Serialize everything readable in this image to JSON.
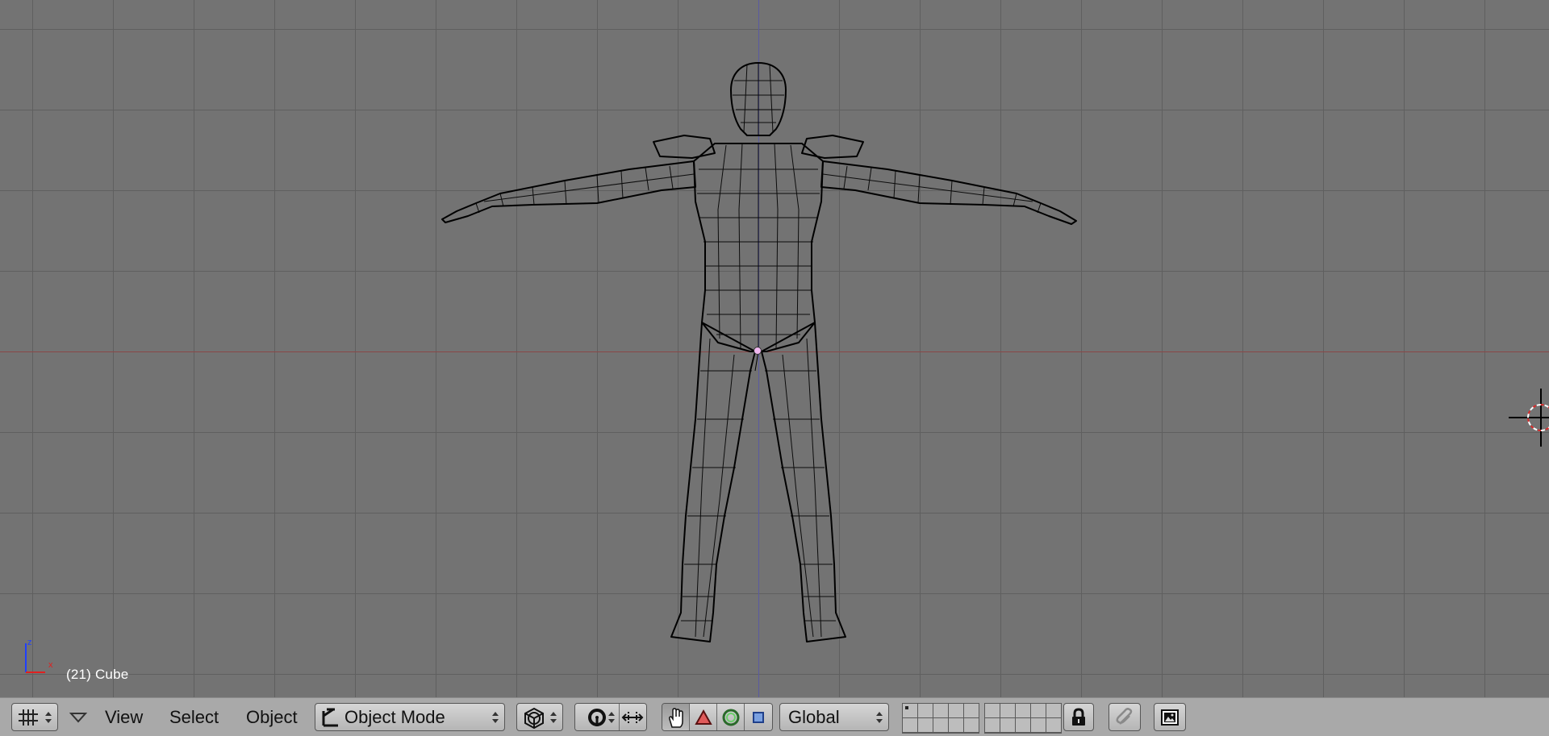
{
  "viewport": {
    "object_info": "(21) Cube",
    "axis_labels": {
      "z": "z",
      "x": "x"
    },
    "colors": {
      "background": "#737373",
      "grid": "#5f5f5f",
      "x_axis": "#8a4848",
      "z_axis": "#5a5aa0",
      "wire": "#000000"
    }
  },
  "header": {
    "window_type_icon": "grid-icon",
    "menus": {
      "view": "View",
      "select": "Select",
      "object": "Object"
    },
    "mode_selector": {
      "value": "Object Mode",
      "icon": "object-mode-icon"
    },
    "draw_type_icon": "wireframe-cube-icon",
    "pivot_icon": "pivot-icon",
    "transform_icons": [
      "hand-icon",
      "triangle-icon",
      "circle-icon",
      "square-icon"
    ],
    "orientation": "Global",
    "lock_icon": "lock-icon",
    "snap_icon": "snap-icon",
    "render_icon": "render-icon"
  }
}
